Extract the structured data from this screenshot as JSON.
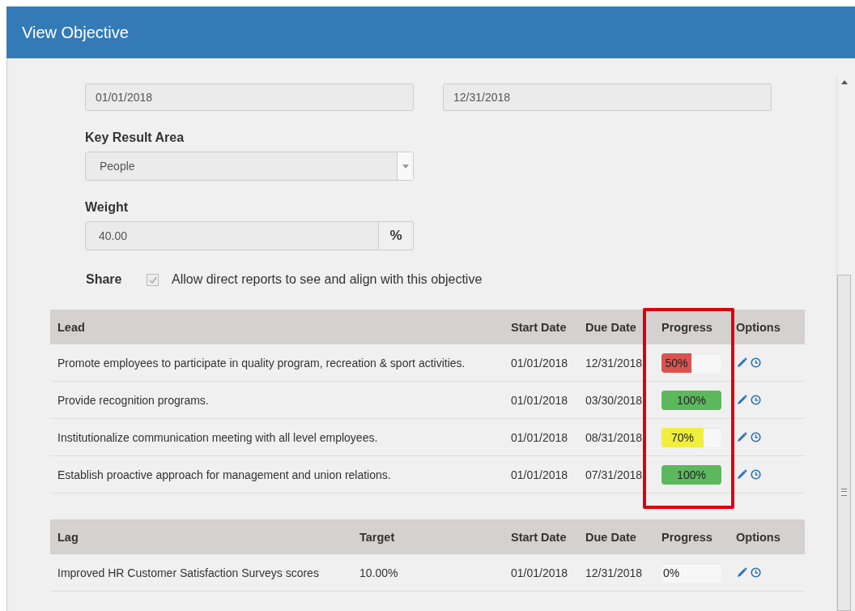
{
  "window": {
    "title": "View Objective"
  },
  "dates": {
    "start": "01/01/2018",
    "end": "12/31/2018"
  },
  "key_result_area": {
    "label": "Key Result Area",
    "value": "People"
  },
  "weight": {
    "label": "Weight",
    "value": "40.00",
    "unit": "%"
  },
  "share": {
    "label": "Share",
    "checked": true,
    "disabled": true,
    "text": "Allow direct reports to see and align with this objective"
  },
  "lead_table": {
    "columns": [
      {
        "label": "Lead",
        "highlighted": false
      },
      {
        "label": "Start Date",
        "highlighted": false
      },
      {
        "label": "Due Date",
        "highlighted": false
      },
      {
        "label": "Progress",
        "highlighted": true
      },
      {
        "label": "Options",
        "highlighted": false
      }
    ],
    "rows": [
      {
        "name": "Promote employees to participate in quality program, recreation & sport activities.",
        "start": "01/01/2018",
        "due": "12/31/2018",
        "level": 0.5,
        "reading": "50%",
        "color": "#d9534f"
      },
      {
        "name": "Provide recognition programs.",
        "start": "01/01/2018",
        "due": "03/30/2018",
        "level": 1,
        "reading": "100%",
        "color": "#5cb85c"
      },
      {
        "name": "Institutionalize communication meeting with all level employees.",
        "start": "01/01/2018",
        "due": "08/31/2018",
        "level": 0.7,
        "reading": "70%",
        "color": "#f0ee3f"
      },
      {
        "name": "Establish proactive approach for management and union relations.",
        "start": "01/01/2018",
        "due": "07/31/2018",
        "level": 1,
        "reading": "100%",
        "color": "#5cb85c"
      }
    ]
  },
  "lag_table": {
    "columns": [
      {
        "label": "Lag"
      },
      {
        "label": "Target"
      },
      {
        "label": "Start Date"
      },
      {
        "label": "Due Date"
      },
      {
        "label": "Progress"
      },
      {
        "label": "Options"
      }
    ],
    "rows": [
      {
        "name": "Improved HR Customer Satisfaction Surveys scores",
        "target": "10.00%",
        "start": "01/01/2018",
        "due": "12/31/2018",
        "reading": "0%"
      }
    ]
  }
}
